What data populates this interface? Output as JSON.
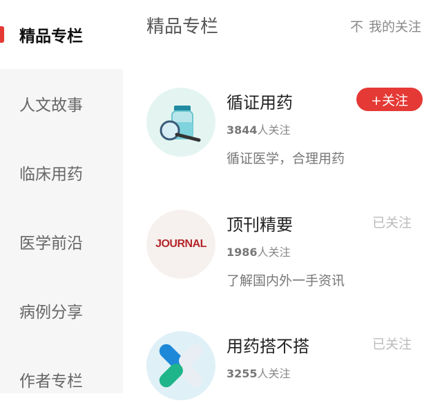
{
  "sidebar": {
    "items": [
      {
        "label": "精品专栏",
        "active": true
      },
      {
        "label": "人文故事"
      },
      {
        "label": "临床用药"
      },
      {
        "label": "医学前沿"
      },
      {
        "label": "病例分享"
      },
      {
        "label": "作者专栏"
      }
    ]
  },
  "header": {
    "title": "精品专栏",
    "follow_link": "我的关注",
    "follow_icon": "不"
  },
  "columns": [
    {
      "title": "循证用药",
      "count": "3844",
      "count_suffix": "人关注",
      "desc": "循证医学，合理用药",
      "button": "+关注",
      "followed": false
    },
    {
      "title": "顶刊精要",
      "count": "1986",
      "count_suffix": "人关注",
      "desc": "了解国内外一手资讯",
      "button": "已关注",
      "followed": true,
      "logo_text": "JOURNAL"
    },
    {
      "title": "用药搭不搭",
      "count": "3255",
      "count_suffix": "人关注",
      "desc": "",
      "button": "已关注",
      "followed": true
    }
  ],
  "colors": {
    "accent": "#e53935",
    "sidebar_bg": "#f6f6f6"
  }
}
